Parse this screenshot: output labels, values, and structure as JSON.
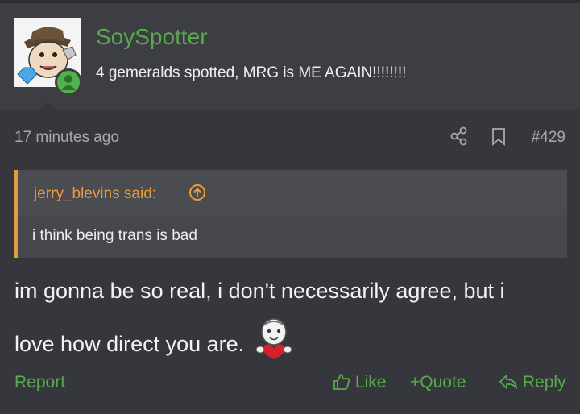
{
  "post": {
    "username": "SoySpotter",
    "user_title": "4 gemeralds spotted, MRG is ME AGAIN!!!!!!!!",
    "time": "17 minutes ago",
    "number": "#429",
    "quote": {
      "author": "jerry_blevins said:",
      "text": "i think being trans is bad"
    },
    "body_line1": "im gonna be so real, i don't necessarily agree, but i",
    "body_line2": "love how direct you are."
  },
  "actions": {
    "report": "Report",
    "like": "Like",
    "quote": "Quote",
    "reply": "Reply"
  },
  "colors": {
    "accent_green": "#59a94f",
    "quote_orange": "#e99a3a",
    "background": "#36373c"
  },
  "icons": {
    "share": "share-icon",
    "bookmark": "bookmark-icon",
    "up": "arrow-up-circle-icon",
    "like": "thumbs-up-icon",
    "reply": "reply-icon"
  }
}
